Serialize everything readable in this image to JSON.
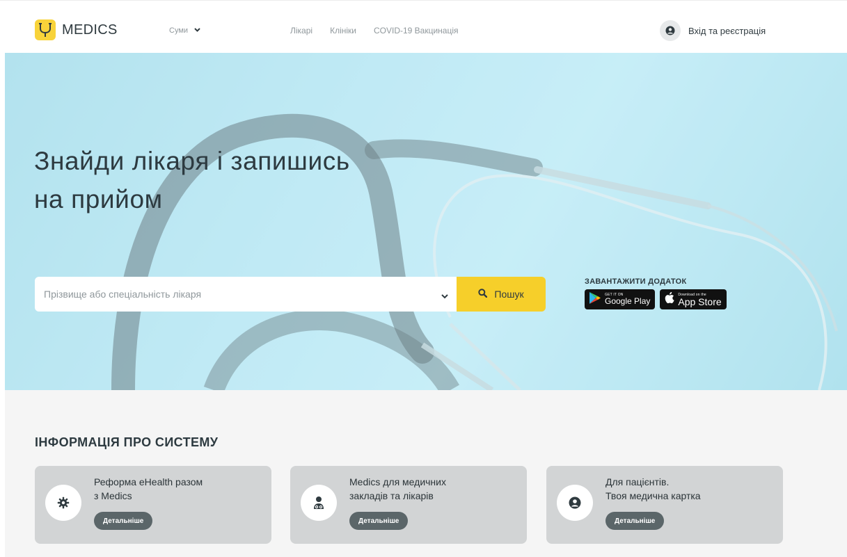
{
  "header": {
    "logo_text": "MEDICS",
    "city": "Суми",
    "nav": [
      "Лікарі",
      "Клініки",
      "COVID-19 Вакцинація"
    ],
    "login_label": "Вхід та реєстрація"
  },
  "hero": {
    "title_line1": "Знайди лікаря і запишись",
    "title_line2": "на прийом",
    "search_placeholder": "Прізвище або спеціальність лікаря",
    "search_button": "Пошук",
    "app_title": "ЗАВАНТАЖИТИ ДОДАТОК",
    "google_small": "GET IT ON",
    "google_big": "Google Play",
    "apple_small": "Download on the",
    "apple_big": "App Store"
  },
  "info": {
    "title": "ІНФОРМАЦІЯ ПРО СИСТЕМУ",
    "cards": [
      {
        "line1": "Реформа eHealth разом",
        "line2": "з Medics",
        "button": "Детальніше",
        "icon": "gear-icon"
      },
      {
        "line1": "Medics для медичних",
        "line2": "закладів та лікарів",
        "button": "Детальніше",
        "icon": "doctor-icon"
      },
      {
        "line1": "Для пацієнтів.",
        "line2": "Твоя медична картка",
        "button": "Детальніше",
        "icon": "user-icon"
      }
    ]
  },
  "colors": {
    "brand_yellow": "#f6cf2a",
    "hero_blue": "#bfe9f5",
    "card_gray": "#d2d4d5",
    "button_dark": "#5b6669"
  }
}
